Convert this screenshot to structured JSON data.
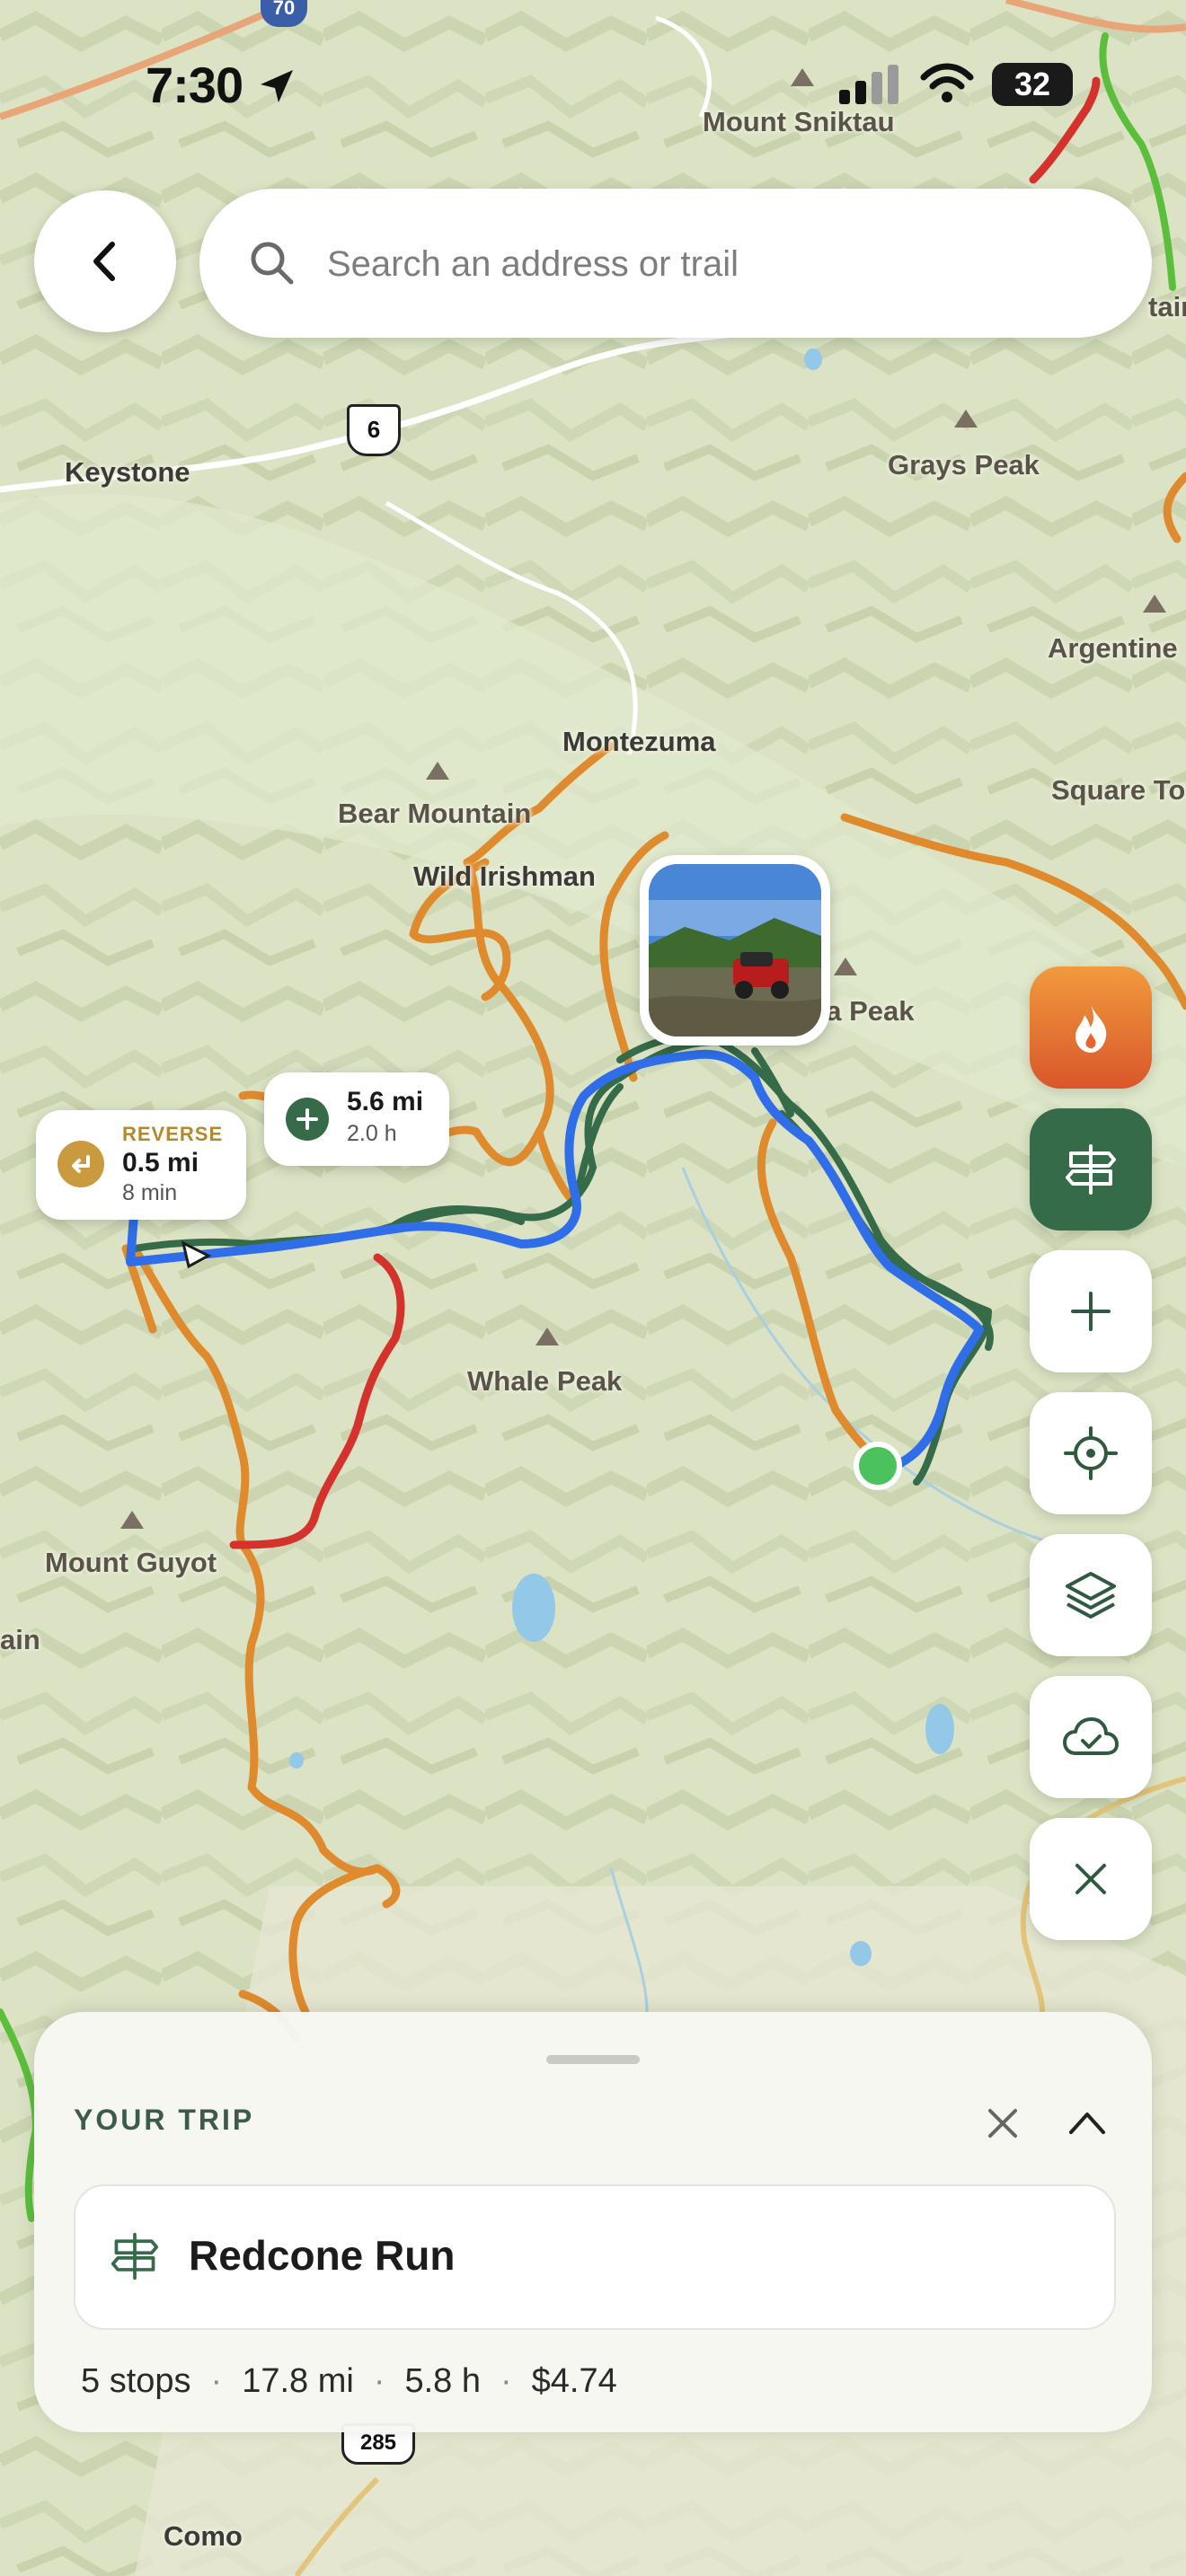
{
  "status_bar": {
    "time": "7:30",
    "battery": "32",
    "peak_label": "Mount Sniktau"
  },
  "search": {
    "placeholder": "Search an address or trail"
  },
  "map": {
    "labels": {
      "keystone": "Keystone",
      "grays_peak": "Grays Peak",
      "argentine": "Argentine",
      "square_top": "Square To",
      "montezuma": "Montezuma",
      "bear_mountain": "Bear Mountain",
      "wild_irishman": "Wild Irishman",
      "geneva_peak": "va Peak",
      "whale_peak": "Whale Peak",
      "mount_guyot": "Mount Guyot",
      "ain": "ain",
      "ntain": "tain",
      "como": "Como"
    },
    "highway_shields": {
      "us6": "6",
      "us285": "285",
      "i70": "70"
    },
    "colors": {
      "route_blue": "#2f6ee8",
      "trail_orange": "#e08a2e",
      "trail_green": "#356b48",
      "trail_red": "#d6322d",
      "trail_lime": "#5bbf3c",
      "start_dot": "#4cc25f"
    }
  },
  "route_chips": {
    "reverse": {
      "title": "REVERSE",
      "distance": "0.5 mi",
      "time": "8 min",
      "icon": "reverse-arrow-icon"
    },
    "add": {
      "distance": "5.6 mi",
      "time": "2.0 h",
      "icon": "plus-icon"
    }
  },
  "side_buttons": [
    {
      "name": "fire-layer",
      "icon": "flame-icon"
    },
    {
      "name": "trip-planner",
      "icon": "signpost-icon"
    },
    {
      "name": "zoom-in",
      "icon": "plus-icon"
    },
    {
      "name": "locate",
      "icon": "crosshair-icon"
    },
    {
      "name": "layers",
      "icon": "layers-icon"
    },
    {
      "name": "offline",
      "icon": "cloud-check-icon"
    },
    {
      "name": "close",
      "icon": "close-icon"
    }
  ],
  "trip_sheet": {
    "label": "YOUR TRIP",
    "trip_name": "Redcone Run",
    "stops": "5 stops",
    "distance": "17.8 mi",
    "duration": "5.8 h",
    "cost": "$4.74",
    "separator": "·"
  }
}
